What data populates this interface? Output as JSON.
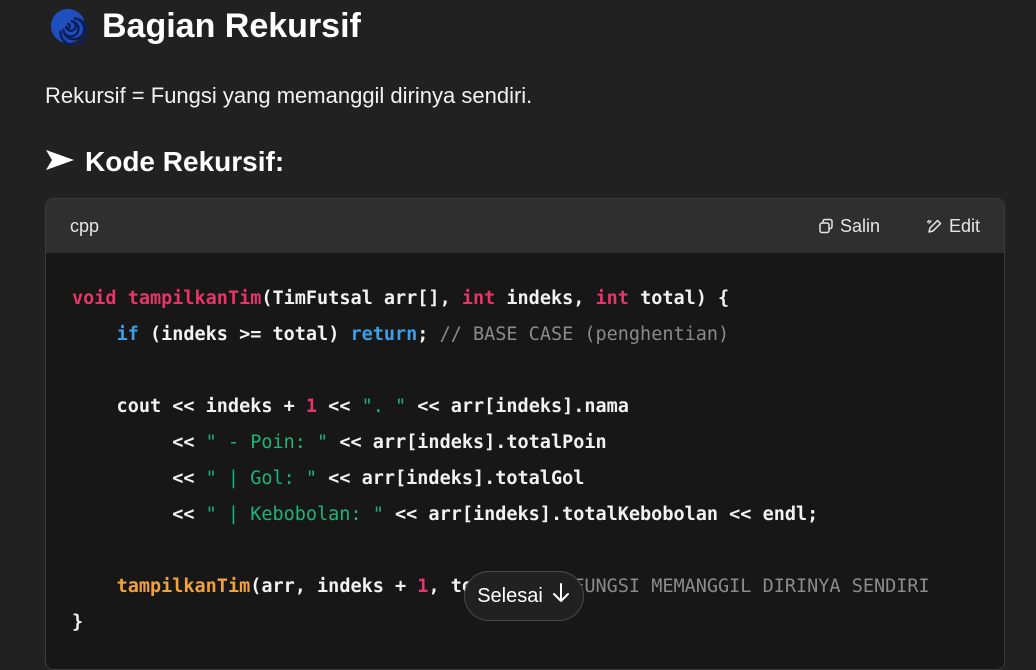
{
  "section": {
    "title": "Bagian Rekursif",
    "icon": "spiral-icon",
    "description": "Rekursif = Fungsi yang memanggil dirinya sendiri."
  },
  "subsection": {
    "title": "Kode Rekursif:",
    "icon": "arrow-right-icon"
  },
  "codeblock": {
    "language": "cpp",
    "copy_label": "Salin",
    "edit_label": "Edit",
    "lines": [
      "void tampilkanTim(TimFutsal arr[], int indeks, int total) {",
      "    if (indeks >= total) return; // BASE CASE (penghentian)",
      "",
      "    cout << indeks + 1 << \". \" << arr[indeks].nama",
      "         << \" - Poin: \" << arr[indeks].totalPoin",
      "         << \" | Gol: \" << arr[indeks].totalGol",
      "         << \" | Kebobolan: \" << arr[indeks].totalKebobolan << endl;",
      "",
      "    tampilkanTim(arr, indeks + 1, total); // FUNGSI MEMANGGIL DIRINYA SENDIRI",
      "}"
    ]
  },
  "done_button": {
    "label": "Selesai",
    "icon": "arrow-down-icon"
  },
  "colors": {
    "background": "#212121",
    "code_background": "#171717",
    "header_background": "#2f2f2f",
    "keyword": "#e8336b",
    "function": "#f2a23a",
    "control": "#3b9ee6",
    "string": "#1fb37a",
    "comment": "#8b8b8b"
  }
}
